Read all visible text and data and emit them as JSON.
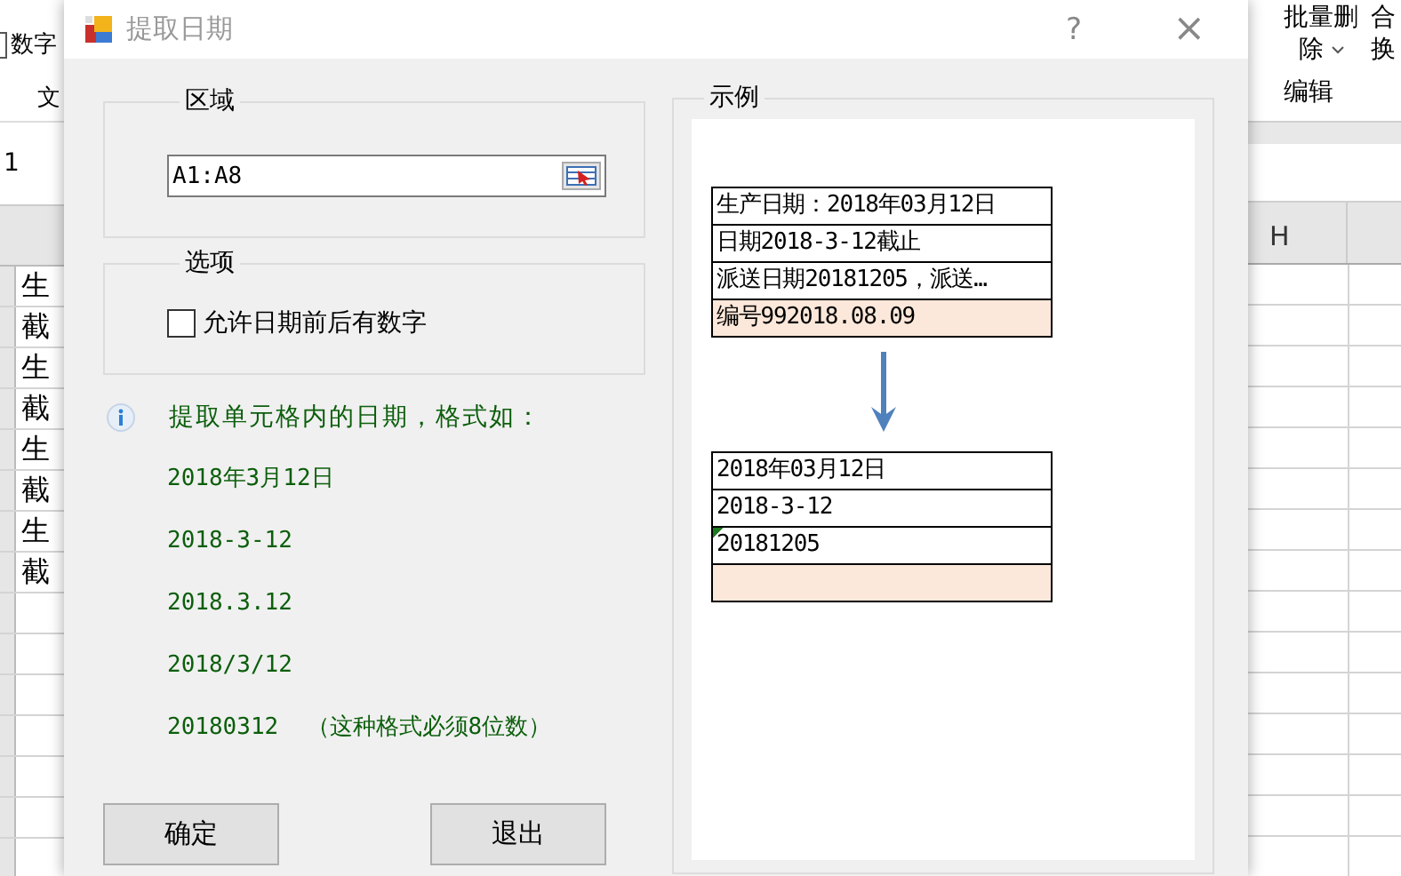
{
  "background": {
    "left": {
      "checkbox": {
        "label": "数字",
        "checked": false
      },
      "tab_fragment": "文",
      "name_box": "1",
      "cells": [
        "生",
        "截",
        "生",
        "截",
        "生",
        "截",
        "生",
        "截"
      ]
    },
    "right": {
      "ribbon_buttons": [
        {
          "lines": [
            "批量删",
            "除"
          ],
          "dropdown": true
        },
        {
          "lines": [
            "合",
            "换"
          ],
          "dropdown": false
        }
      ],
      "group_label": "编辑",
      "column_header": "H"
    }
  },
  "dialog": {
    "title": "提取日期",
    "help": "?",
    "close": "×",
    "region": {
      "label": "区域",
      "value": "A1:A8"
    },
    "options": {
      "label": "选项",
      "checkbox": {
        "label": "允许日期前后有数字",
        "checked": false
      }
    },
    "info": {
      "text": "提取单元格内的日期，格式如：",
      "formats": [
        "2018年3月12日",
        "2018-3-12",
        "2018.3.12",
        "2018/3/12",
        "20180312  （这种格式必须8位数）"
      ]
    },
    "buttons": [
      "确定",
      "退出"
    ],
    "example": {
      "label": "示例",
      "source_rows": [
        {
          "text": "生产日期：2018年03月12日",
          "highlighted": false
        },
        {
          "text": "日期2018-3-12截止",
          "highlighted": false
        },
        {
          "text": "派送日期20181205，派送…",
          "highlighted": false
        },
        {
          "text": "编号992018.08.09",
          "highlighted": true
        }
      ],
      "result_rows": [
        {
          "text": "2018年03月12日",
          "highlighted": false,
          "flag": false
        },
        {
          "text": "2018-3-12",
          "highlighted": false,
          "flag": false
        },
        {
          "text": "20181205",
          "highlighted": false,
          "flag": true
        },
        {
          "highlighted": true,
          "flag": false
        }
      ]
    }
  }
}
